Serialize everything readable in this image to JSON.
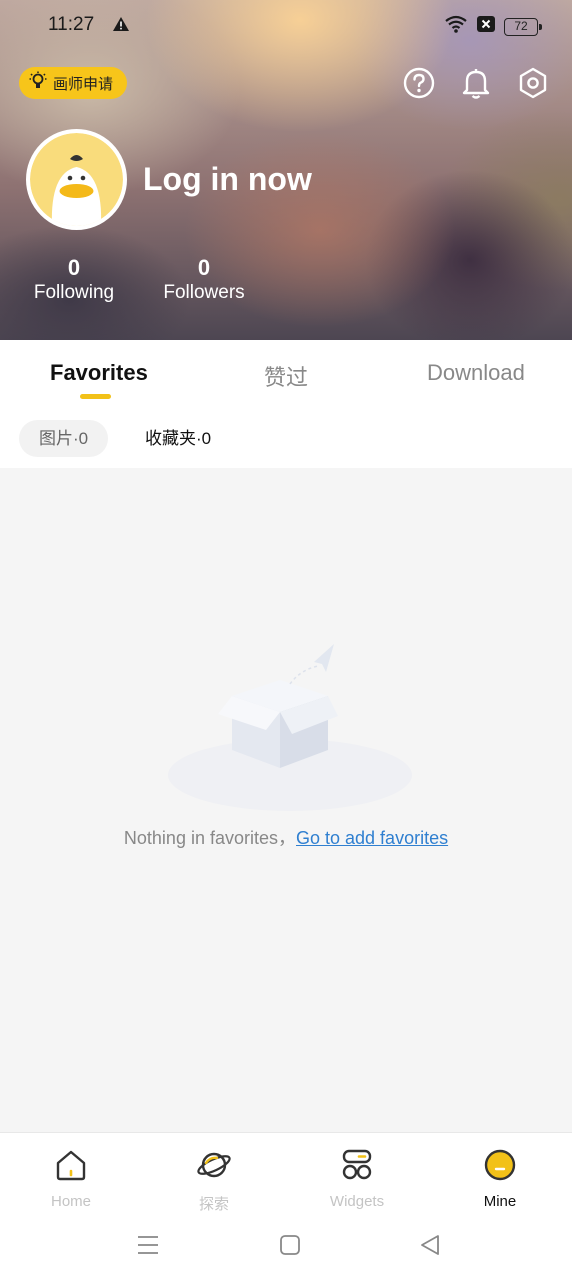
{
  "status_bar": {
    "time": "11:27",
    "battery": "72"
  },
  "header": {
    "apply_chip_label": "画师申请",
    "login_text": "Log in now",
    "stats": [
      {
        "num": "0",
        "label": "Following"
      },
      {
        "num": "0",
        "label": "Followers"
      }
    ]
  },
  "tabs": [
    "Favorites",
    "赞过",
    "Download"
  ],
  "sub_tabs": [
    "图片·0",
    "收藏夹·0"
  ],
  "empty": {
    "message": "Nothing in favorites，",
    "link": "Go to add favorites"
  },
  "bottom_nav": [
    "Home",
    "探索",
    "Widgets",
    "Mine"
  ],
  "colors": {
    "accent": "#f2c118",
    "link": "#2f7fd0"
  },
  "icons": {
    "top_right": [
      "help-icon",
      "bell-icon",
      "settings-icon"
    ],
    "system_nav": [
      "menu-icon",
      "home-square-icon",
      "back-icon"
    ]
  }
}
